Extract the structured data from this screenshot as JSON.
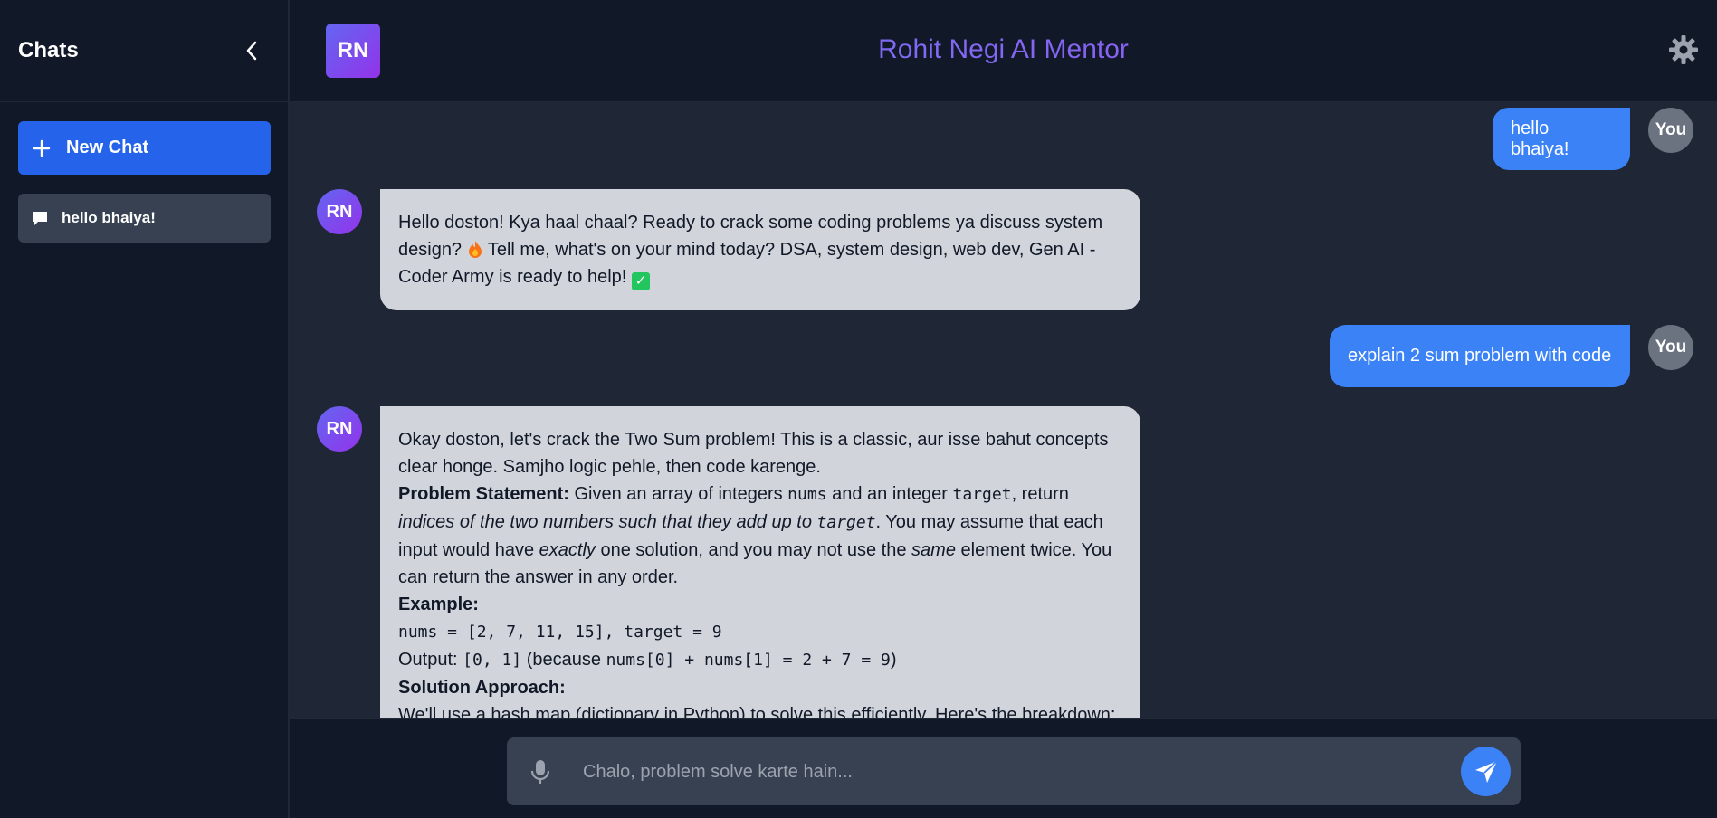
{
  "sidebar": {
    "title": "Chats",
    "new_chat_label": "New Chat",
    "chats": [
      {
        "label": "hello bhaiya!"
      }
    ]
  },
  "header": {
    "logo_text": "RN",
    "title": "Rohit Negi AI Mentor"
  },
  "messages": [
    {
      "role": "user",
      "avatar": "You",
      "text": "hello bhaiya!"
    },
    {
      "role": "bot",
      "avatar": "RN"
    },
    {
      "role": "user",
      "avatar": "You",
      "text": "explain 2 sum problem with code"
    },
    {
      "role": "bot",
      "avatar": "RN"
    }
  ],
  "bot_msg_1": {
    "line1": "Hello doston! Kya haal chaal? Ready to crack some coding problems ya discuss system design? ",
    "line2": " Tell me, what's on your mind today? DSA, system design, web dev, Gen AI - Coder Army is ready to help! "
  },
  "bot_msg_2": {
    "intro": "Okay doston, let's crack the Two Sum problem! This is a classic, aur isse bahut concepts clear honge. Samjho logic pehle, then code karenge.",
    "ps_label": "Problem Statement:",
    "ps_a": " Given an array of integers ",
    "ps_nums": "nums",
    "ps_b": " and an integer ",
    "ps_target": "target",
    "ps_c": ", return ",
    "ps_italic": "indices of the two numbers such that they add up to ",
    "ps_target2": "target",
    "ps_d": ". You may assume that each input would have ",
    "ps_exactly": "exactly",
    "ps_e": " one solution, and you may not use the ",
    "ps_same": "same",
    "ps_f": " element twice. You can return the answer in any order.",
    "ex_label": "Example:",
    "ex_code": "nums = [2, 7, 11, 15], target = 9",
    "out_label": "Output: ",
    "out_code": "[0, 1]",
    "out_b": " (because ",
    "out_code2": "nums[0] + nums[1] = 2 + 7 = 9",
    "out_c": ")",
    "sa_label": "Solution Approach:",
    "sa_text": "We'll use a hash map (dictionary in Python) to solve this efficiently. Here's the breakdown:"
  },
  "input": {
    "placeholder": "Chalo, problem solve karte hain..."
  },
  "colors": {
    "accent": "#3b82f6",
    "new_chat": "#2563eb",
    "bot_bubble": "#d1d5db",
    "sidebar_bg": "#111827",
    "chat_bg": "#1f2736"
  },
  "icons": [
    "chevron-left-icon",
    "plus-icon",
    "chat-bubble-icon",
    "gear-icon",
    "mic-icon",
    "send-icon"
  ]
}
